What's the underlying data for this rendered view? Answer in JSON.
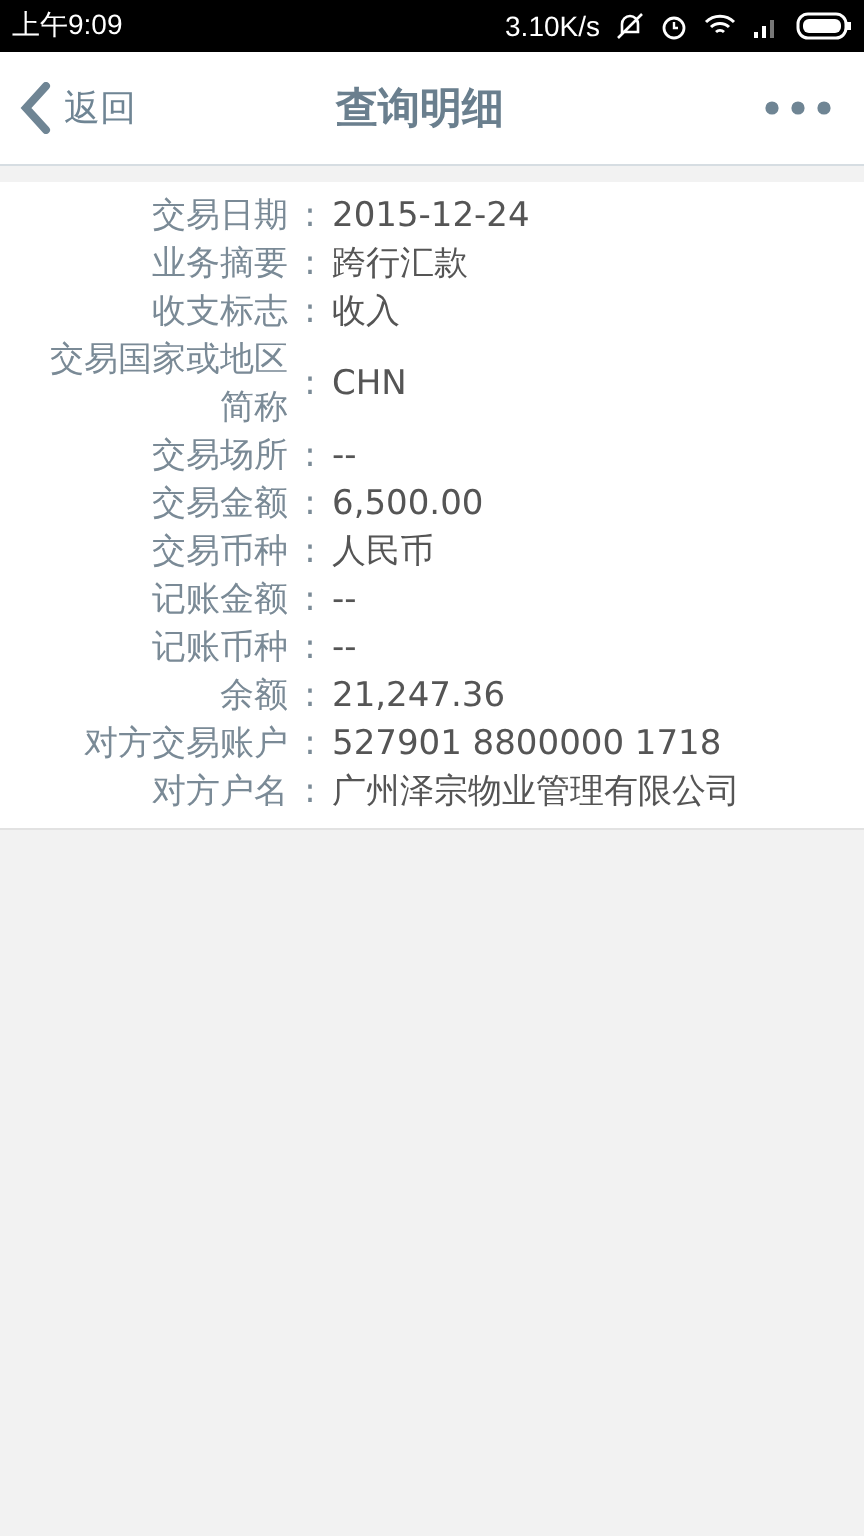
{
  "status_bar": {
    "time": "上午9:09",
    "speed": "3.10K/s"
  },
  "header": {
    "back": "返回",
    "title": "查询明细"
  },
  "details": [
    {
      "label": "交易日期",
      "separator": ":",
      "value": "2015-12-24"
    },
    {
      "label": "业务摘要",
      "separator": ":",
      "value": "跨行汇款"
    },
    {
      "label": "收支标志",
      "separator": ":",
      "value": "收入"
    },
    {
      "label": "交易国家或地区简称",
      "separator": ":",
      "value": "CHN"
    },
    {
      "label": "交易场所",
      "separator": ":",
      "value": "--"
    },
    {
      "label": "交易金额",
      "separator": ":",
      "value": "6,500.00"
    },
    {
      "label": "交易币种",
      "separator": ":",
      "value": "人民币"
    },
    {
      "label": "记账金额",
      "separator": ":",
      "value": "--"
    },
    {
      "label": "记账币种",
      "separator": ":",
      "value": "--"
    },
    {
      "label": "余额",
      "separator": ":",
      "value": "21,247.36"
    },
    {
      "label": "对方交易账户",
      "separator": ":",
      "value": "527901 8800000 1718"
    },
    {
      "label": "对方户名",
      "separator": ":",
      "value": "广州泽宗物业管理有限公司"
    }
  ]
}
